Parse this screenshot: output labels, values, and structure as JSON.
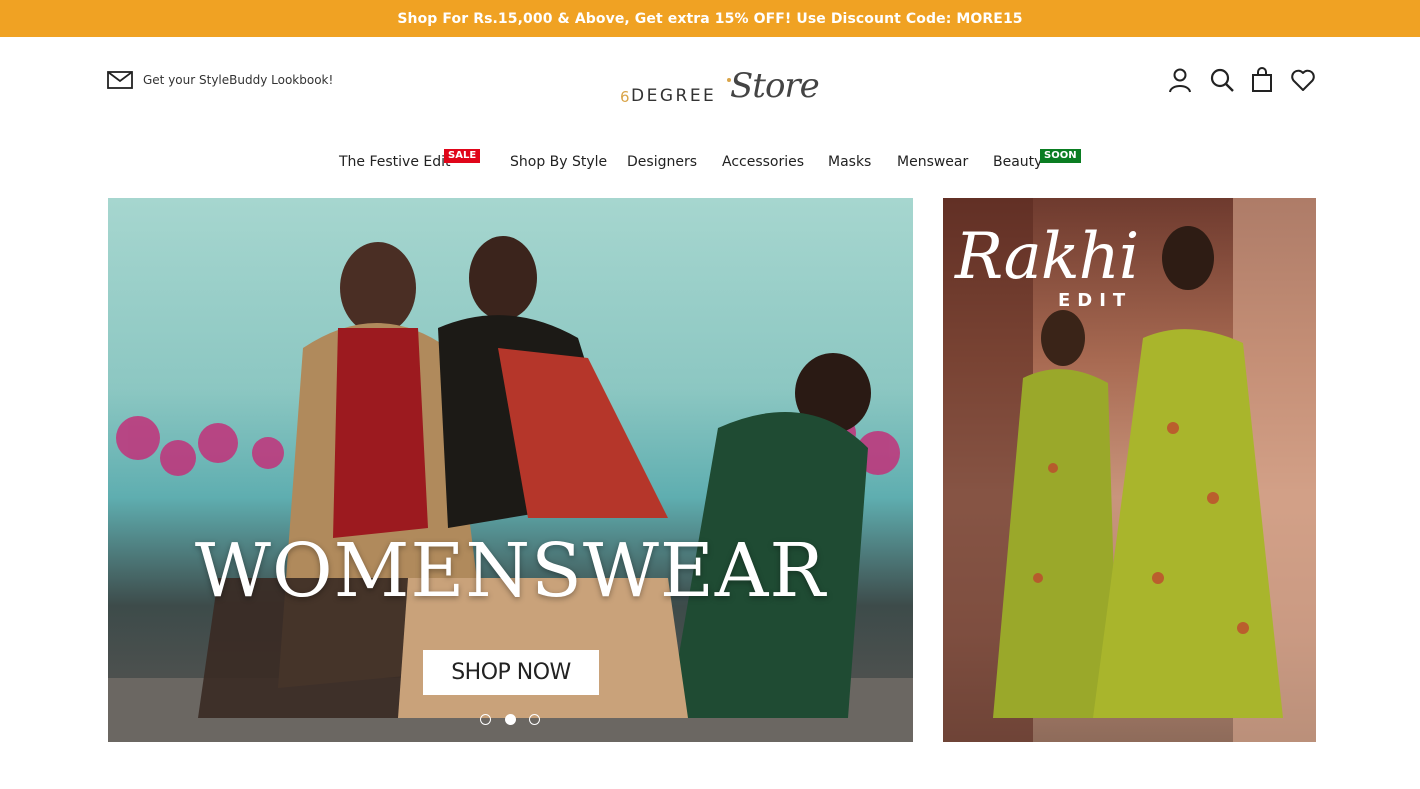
{
  "promo": {
    "text": "Shop For Rs.15,000 & Above, Get extra 15% OFF! Use Discount Code: MORE15",
    "background": "#f0a223"
  },
  "header": {
    "lookbook_text": "Get your StyleBuddy Lookbook!",
    "lookbook_icon": "mail-icon",
    "logo": {
      "six": "6",
      "degree": "DEGREE",
      "store": "Store"
    },
    "icons": [
      "account-icon",
      "search-icon",
      "cart-icon",
      "wishlist-icon"
    ]
  },
  "nav": {
    "items": [
      {
        "label": "The Festive Edit",
        "badge": "SALE"
      },
      {
        "label": "Shop By Style"
      },
      {
        "label": "Designers"
      },
      {
        "label": "Accessories"
      },
      {
        "label": "Masks"
      },
      {
        "label": "Menswear"
      },
      {
        "label": "Beauty",
        "badge": "SOON"
      }
    ],
    "badge_colors": {
      "sale": "#e0061a",
      "soon": "#0a7d22"
    }
  },
  "hero": {
    "title": "WOMENSWEAR",
    "button": "SHOP NOW",
    "slides": 3,
    "active_slide": 2
  },
  "side_banner": {
    "title": "Rakhi",
    "subtitle": "EDIT"
  }
}
